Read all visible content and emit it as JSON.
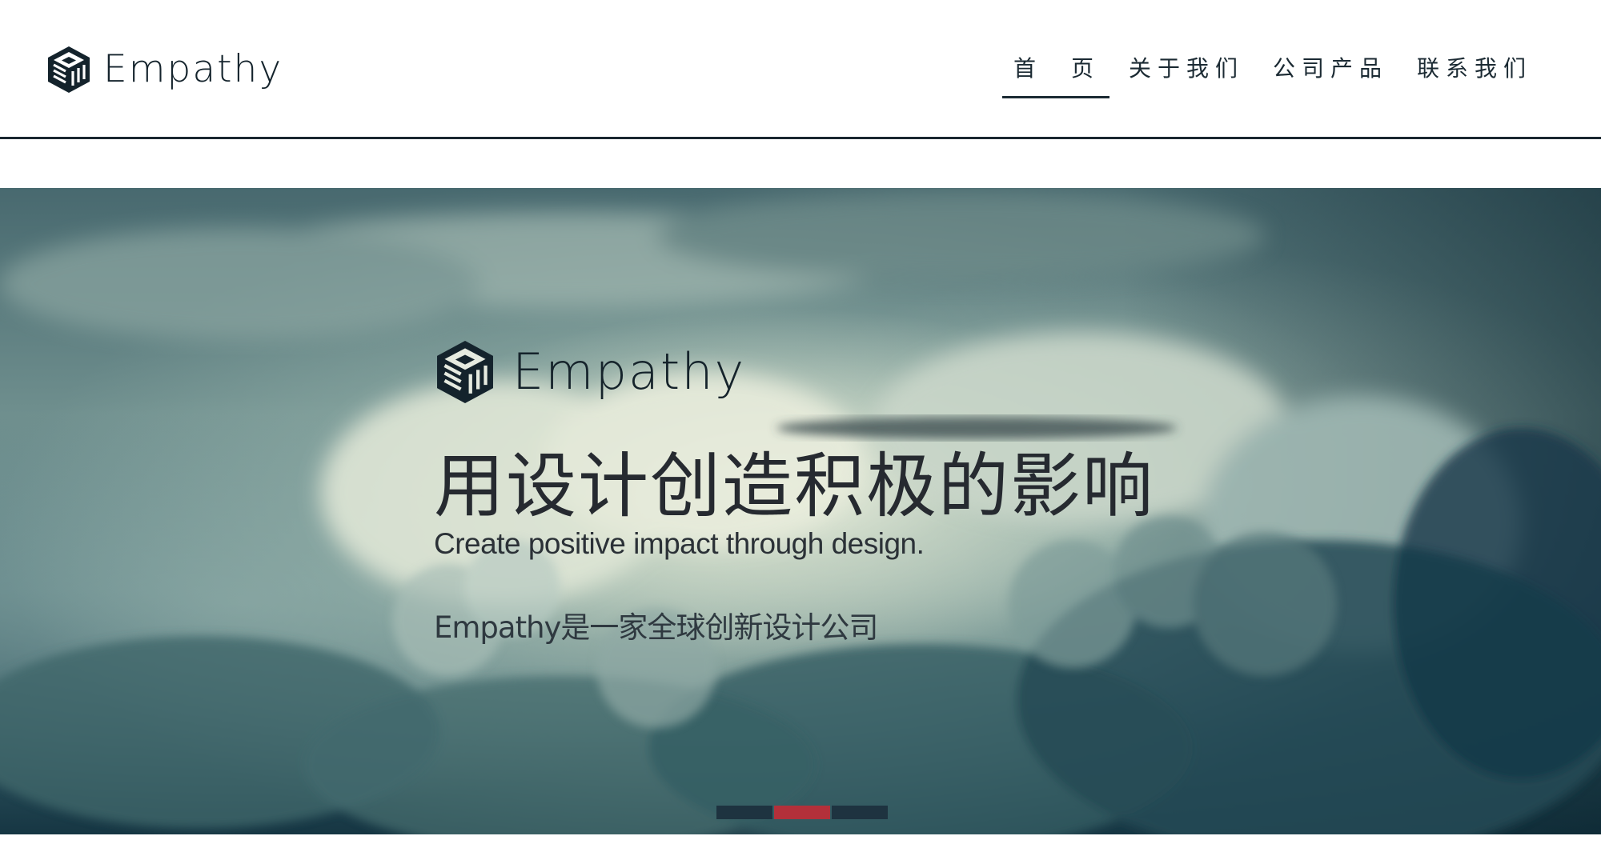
{
  "header": {
    "brand_name": "Empathy",
    "nav": [
      {
        "label": "首　页",
        "active": true
      },
      {
        "label": "关于我们",
        "active": false
      },
      {
        "label": "公司产品",
        "active": false
      },
      {
        "label": "联系我们",
        "active": false
      }
    ]
  },
  "hero": {
    "brand_name": "Empathy",
    "title": "用设计创造积极的影响",
    "subtitle": "Create positive impact through design.",
    "description": "Empathy是一家全球创新设计公司"
  },
  "slider": {
    "count": 3,
    "active_index": 1
  },
  "colors": {
    "brand_dark": "#14232c",
    "slider_active": "#b3303a",
    "slider_inactive": "#1e3340"
  },
  "icons": {
    "brand": "cube-logo-icon"
  }
}
